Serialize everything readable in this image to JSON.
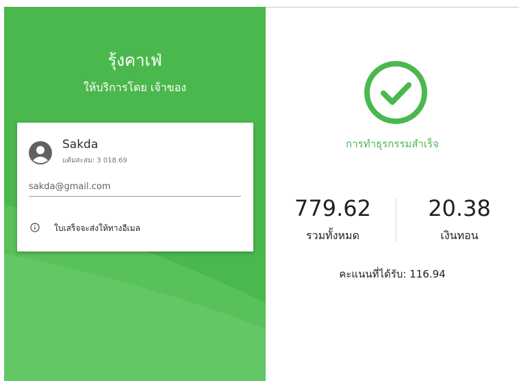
{
  "store": {
    "name": "รุ้งคาเฟ่",
    "served_by": "ให้บริการโดย เจ้าของ"
  },
  "customer": {
    "name": "Sakda",
    "points_text": "แต้มสะสม: 3 018.69",
    "email": "sakda@gmail.com",
    "receipt_note": "ใบเสร็จจะส่งให้ทางอีเมล"
  },
  "result": {
    "status_text": "การทำธุรกรรมสำเร็จ",
    "total_value": "779.62",
    "total_label": "รวมทั้งหมด",
    "change_value": "20.38",
    "change_label": "เงินทอน",
    "points_earned_text": "คะแนนที่ได้รับ: 116.94"
  },
  "icons": {
    "avatar": "account-circle-icon",
    "info": "info-outline-icon",
    "success": "check-circle-icon"
  },
  "colors": {
    "brand_green": "#4bb84e",
    "text_dark": "#212121"
  }
}
